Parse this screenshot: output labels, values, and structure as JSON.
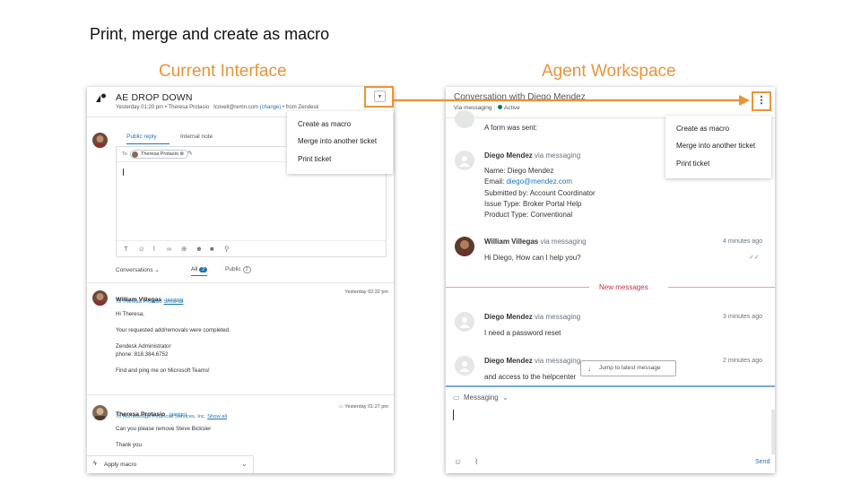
{
  "slide_title": "Print, merge and create as macro",
  "current_heading": "Current Interface",
  "agent_heading": "Agent Workspace",
  "colors": {
    "accent": "#e8943a",
    "link": "#1f73b7",
    "active": "#038153",
    "new_messages": "#cc3340"
  },
  "current": {
    "ticket_title": "AE DROP DOWN",
    "meta": "Yesterday 01:20 pm • Theresa Protasio",
    "meta_email": "tcovell@remn.com",
    "meta_change": "(change)",
    "meta_from": "• from Zendesk",
    "dropdown_icon": "chevron-down-icon",
    "tabs": {
      "public": "Public reply",
      "internal": "Internal note"
    },
    "to_label": "To",
    "to_chip": "Theresa Protasio",
    "filters": {
      "conversations": "Conversations ⌄",
      "all": "All",
      "all_count": "2",
      "public": "Public",
      "public_count": "2"
    },
    "menu": [
      "Create as macro",
      "Merge into another ticket",
      "Print ticket"
    ],
    "messages": [
      {
        "author": "William Villegas",
        "assign": "(assign)",
        "time": "Yesterday 02:32 pm",
        "to": "To Theresa Protasio",
        "to_link": "Show all",
        "body": [
          "Hi Theresa,",
          "",
          "Your requested add/removals were completed.",
          "",
          "Zendesk Administrator",
          "phone: 818.384.6752",
          "",
          "Find and ping me on Microsoft Teams!"
        ]
      },
      {
        "author": "Theresa Protasio",
        "assign": "(assign)",
        "time": "Yesterday 01:27 pm",
        "to": "To Homebridge Financial Services, Inc.",
        "to_link": "Show all",
        "body": [
          "Can you please remove Steve Bicksler",
          "",
          "Thank you"
        ]
      }
    ],
    "apply_macro": "Apply macro"
  },
  "agent": {
    "title": "Conversation with Diego Mendez",
    "status_channel": "Via messaging",
    "status": "Active",
    "menu": [
      "Create as macro",
      "Merge into another ticket",
      "Print ticket"
    ],
    "form_sent": "A form was sent:",
    "msg1": {
      "author": "Diego Mendez",
      "via": "via messaging",
      "lines": [
        "Name: Diego Mendez",
        "Email: ",
        "Submitted by: Account Coordinator",
        "Issue Type: Broker Portal Help",
        "Product Type: Conventional"
      ],
      "email": "diego@mendez.com"
    },
    "msg2": {
      "author": "William Villegas",
      "via": "via messaging",
      "time": "4 minutes ago",
      "body": "Hi Diego, How can I help you?"
    },
    "new_messages": "New messages",
    "msg3": {
      "author": "Diego Mendez",
      "via": "via messaging",
      "time": "3 minutes ago",
      "body": "I need a password reset"
    },
    "msg4": {
      "author": "Diego Mendez",
      "via": "via messaging",
      "time": "2 minutes ago",
      "body": "and access to the helpcenter"
    },
    "jump": "Jump to latest message",
    "channel": "Messaging",
    "send": "Send"
  }
}
